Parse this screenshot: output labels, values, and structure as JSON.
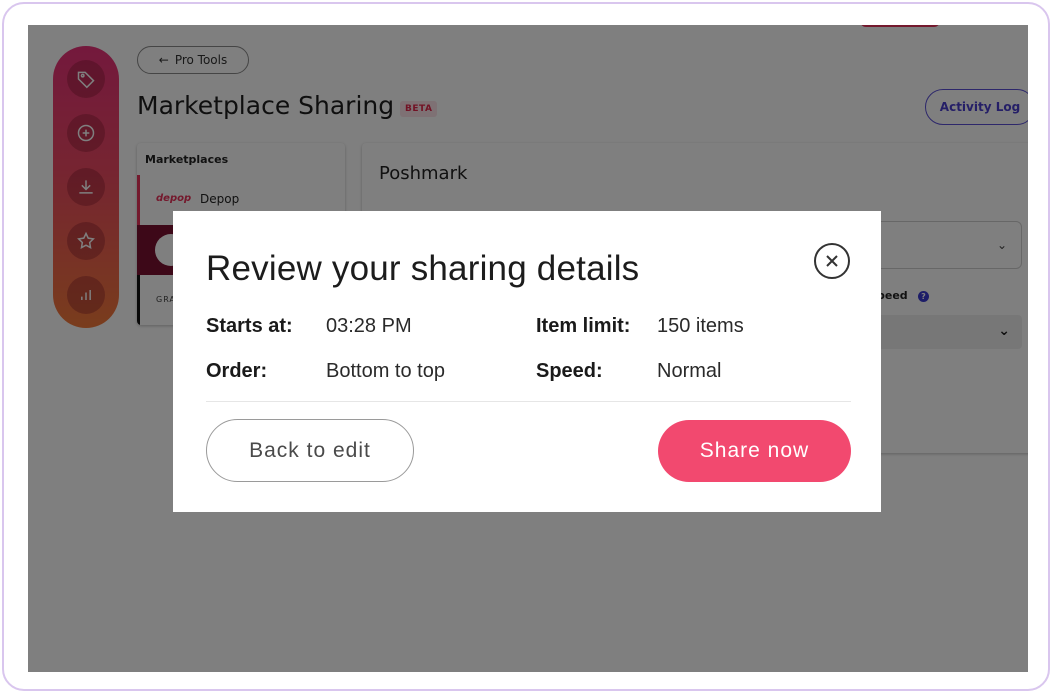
{
  "header": {
    "back_label": "Pro Tools",
    "title": "Marketplace Sharing",
    "badge": "BETA",
    "activity_log": "Activity Log"
  },
  "sidebar": {
    "items": [
      {
        "icon": "tag-icon"
      },
      {
        "icon": "plus-circle-icon"
      },
      {
        "icon": "download-icon"
      },
      {
        "icon": "star-icon"
      },
      {
        "icon": "bar-chart-icon"
      }
    ]
  },
  "marketplaces": {
    "heading": "Marketplaces",
    "depop_logo": "depop",
    "depop_name": "Depop",
    "other_label": "GRA"
  },
  "panel": {
    "title": "Poshmark",
    "speed_label": "peed",
    "help": "?"
  },
  "modal": {
    "title": "Review your sharing details",
    "details": {
      "starts_label": "Starts at:",
      "starts_value": "03:28 PM",
      "limit_label": "Item limit:",
      "limit_value": "150 items",
      "order_label": "Order:",
      "order_value": "Bottom to top",
      "speed_label": "Speed:",
      "speed_value": "Normal"
    },
    "back_button": "Back to edit",
    "share_button": "Share now"
  },
  "colors": {
    "accent_pink": "#f2496f",
    "rail_top": "#e8327a",
    "rail_bottom": "#f37a3a",
    "activity_purple": "#4a3fcf"
  }
}
